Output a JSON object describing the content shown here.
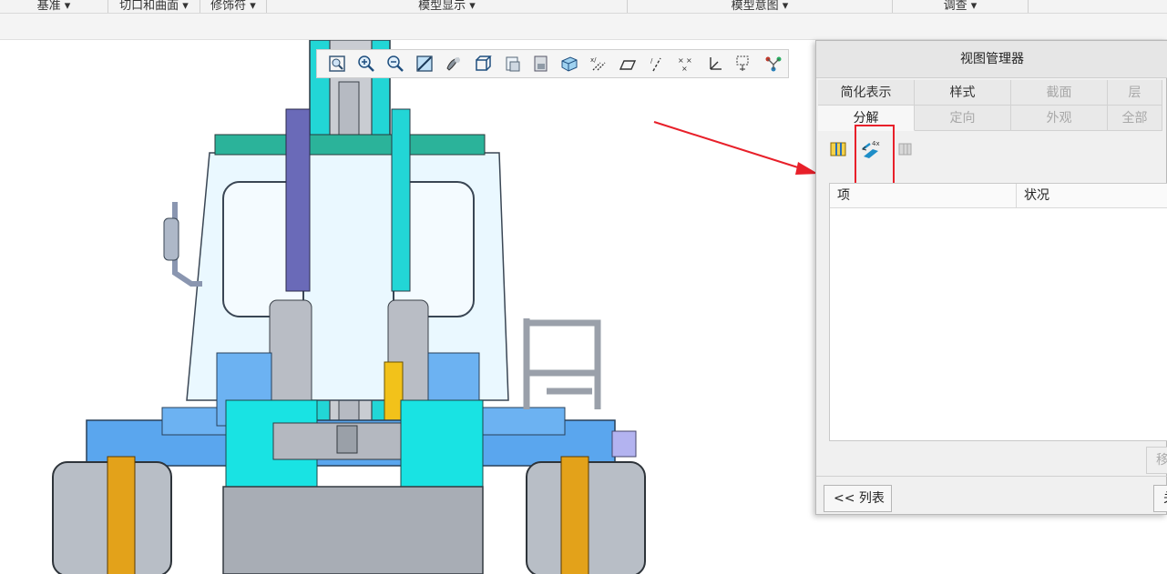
{
  "ribbon": {
    "groups": [
      {
        "label": "基准 ▾"
      },
      {
        "label": "切口和曲面 ▾"
      },
      {
        "label": "修饰符 ▾"
      },
      {
        "label": "模型显示 ▾"
      },
      {
        "label": "模型意图 ▾"
      },
      {
        "label": "调查 ▾"
      }
    ]
  },
  "graphics_toolbar": {
    "icons": [
      "zoom-refit-icon",
      "zoom-in-icon",
      "zoom-out-icon",
      "repaint-icon",
      "display-style-icon",
      "named-views-icon",
      "view-manager-icon",
      "saved-orientations-icon",
      "perspective-icon",
      "datum-plane-display-icon",
      "datum-axis-display-icon",
      "datum-point-display-icon",
      "csys-display-icon",
      "annotation-display-icon",
      "spin-center-icon"
    ]
  },
  "view_manager": {
    "title": "视图管理器",
    "tabs_row1": [
      {
        "label": "简化表示",
        "state": "normal"
      },
      {
        "label": "样式",
        "state": "normal"
      },
      {
        "label": "截面",
        "state": "disabled"
      },
      {
        "label": "层",
        "state": "disabled"
      }
    ],
    "tabs_row2": [
      {
        "label": "分解",
        "state": "active"
      },
      {
        "label": "定向",
        "state": "disabled"
      },
      {
        "label": "外观",
        "state": "disabled"
      },
      {
        "label": "全部",
        "state": "disabled"
      }
    ],
    "table": {
      "col_item": "项",
      "col_status": "状况"
    },
    "move_button": "移",
    "list_button": "<< 列表",
    "close_button": "关"
  },
  "colors": {
    "annotation_red": "#e8202a",
    "body_blue": "#5aa6ee",
    "cyan": "#19e3e3"
  }
}
